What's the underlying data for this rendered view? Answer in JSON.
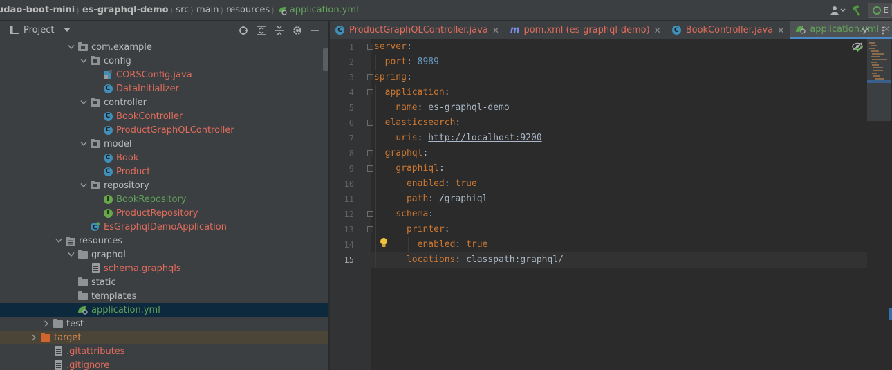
{
  "breadcrumb": {
    "items": [
      "udao-boot-mini",
      "es-graphql-demo",
      "src",
      "main",
      "resources"
    ],
    "file": "application.yml"
  },
  "nav_right": {
    "run_config_label": "E"
  },
  "project_panel": {
    "title": "Project",
    "tree": [
      {
        "label": "com.example",
        "indent": 0,
        "kind": "package",
        "open": true,
        "color": "normal"
      },
      {
        "label": "config",
        "indent": 1,
        "kind": "package",
        "open": true,
        "color": "normal"
      },
      {
        "label": "CORSConfig.java",
        "indent": 2,
        "kind": "java-file",
        "color": "red"
      },
      {
        "label": "DataInitializer",
        "indent": 2,
        "kind": "class",
        "color": "red"
      },
      {
        "label": "controller",
        "indent": 1,
        "kind": "package",
        "open": true,
        "color": "normal"
      },
      {
        "label": "BookController",
        "indent": 2,
        "kind": "class",
        "color": "red"
      },
      {
        "label": "ProductGraphQLController",
        "indent": 2,
        "kind": "class",
        "color": "red"
      },
      {
        "label": "model",
        "indent": 1,
        "kind": "package",
        "open": true,
        "color": "normal"
      },
      {
        "label": "Book",
        "indent": 2,
        "kind": "class",
        "color": "red"
      },
      {
        "label": "Product",
        "indent": 2,
        "kind": "class",
        "color": "red"
      },
      {
        "label": "repository",
        "indent": 1,
        "kind": "package",
        "open": true,
        "color": "normal"
      },
      {
        "label": "BookRepository",
        "indent": 2,
        "kind": "interface",
        "color": "green"
      },
      {
        "label": "ProductRepository",
        "indent": 2,
        "kind": "interface",
        "color": "red"
      },
      {
        "label": "EsGraphqlDemoApplication",
        "indent": 1,
        "kind": "spring-app",
        "color": "red"
      },
      {
        "label": "resources",
        "indent": -1,
        "kind": "resources",
        "open": true,
        "color": "normal"
      },
      {
        "label": "graphql",
        "indent": 0,
        "kind": "folder",
        "open": true,
        "color": "normal"
      },
      {
        "label": "schema.graphqls",
        "indent": 1,
        "kind": "file",
        "color": "red"
      },
      {
        "label": "static",
        "indent": 0,
        "kind": "folder",
        "color": "normal"
      },
      {
        "label": "templates",
        "indent": 0,
        "kind": "folder",
        "color": "normal"
      },
      {
        "label": "application.yml",
        "indent": 0,
        "kind": "yml",
        "color": "green",
        "selected": true
      },
      {
        "label": "test",
        "indent": -2,
        "kind": "folder",
        "open": false,
        "color": "normal"
      },
      {
        "label": "target",
        "indent": -3,
        "kind": "folder-orange",
        "open": false,
        "color": "orange",
        "excluded": true
      },
      {
        "label": ".gitattributes",
        "indent": -2,
        "kind": "file",
        "color": "red"
      },
      {
        "label": ".gitignore",
        "indent": -2,
        "kind": "file",
        "color": "red"
      }
    ]
  },
  "tabs": [
    {
      "label": "ProductGraphQLController.java",
      "icon": "class-icon",
      "active": false
    },
    {
      "label": "pom.xml (es-graphql-demo)",
      "icon": "maven-icon",
      "active": false
    },
    {
      "label": "BookController.java",
      "icon": "class-icon",
      "active": false
    },
    {
      "label": "application.yml",
      "icon": "yml-icon",
      "active": true
    }
  ],
  "editor": {
    "current_line": 15,
    "lines": [
      {
        "n": "1",
        "indent": 0,
        "key": "server",
        "sep": ":",
        "value": "",
        "vtype": ""
      },
      {
        "n": "2",
        "indent": 1,
        "key": "port",
        "sep": ": ",
        "value": "8989",
        "vtype": "num"
      },
      {
        "n": "3",
        "indent": 0,
        "key": "spring",
        "sep": ":",
        "value": "",
        "vtype": ""
      },
      {
        "n": "4",
        "indent": 1,
        "key": "application",
        "sep": ":",
        "value": "",
        "vtype": ""
      },
      {
        "n": "5",
        "indent": 2,
        "key": "name",
        "sep": ": ",
        "value": "es-graphql-demo",
        "vtype": "val"
      },
      {
        "n": "6",
        "indent": 1,
        "key": "elasticsearch",
        "sep": ":",
        "value": "",
        "vtype": ""
      },
      {
        "n": "7",
        "indent": 2,
        "key": "uris",
        "sep": ": ",
        "value": "http://localhost:9200",
        "vtype": "url"
      },
      {
        "n": "8",
        "indent": 1,
        "key": "graphql",
        "sep": ":",
        "value": "",
        "vtype": ""
      },
      {
        "n": "9",
        "indent": 2,
        "key": "graphiql",
        "sep": ":",
        "value": "",
        "vtype": ""
      },
      {
        "n": "10",
        "indent": 3,
        "key": "enabled",
        "sep": ": ",
        "value": "true",
        "vtype": "key"
      },
      {
        "n": "11",
        "indent": 3,
        "key": "path",
        "sep": ": ",
        "value": "/graphiql",
        "vtype": "val"
      },
      {
        "n": "12",
        "indent": 2,
        "key": "schema",
        "sep": ":",
        "value": "",
        "vtype": ""
      },
      {
        "n": "13",
        "indent": 3,
        "key": "printer",
        "sep": ":",
        "value": "",
        "vtype": ""
      },
      {
        "n": "14",
        "indent": 4,
        "key": "enabled",
        "sep": ": ",
        "value": "true",
        "vtype": "key"
      },
      {
        "n": "15",
        "indent": 3,
        "key": "locations",
        "sep": ": ",
        "value": "classpath:graphql/",
        "vtype": "val"
      }
    ]
  }
}
